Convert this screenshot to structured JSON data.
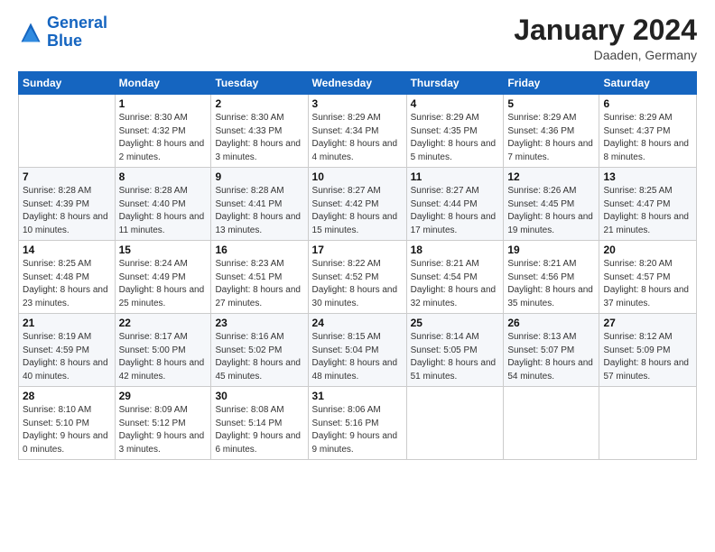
{
  "logo": {
    "line1": "General",
    "line2": "Blue"
  },
  "title": "January 2024",
  "location": "Daaden, Germany",
  "days_header": [
    "Sunday",
    "Monday",
    "Tuesday",
    "Wednesday",
    "Thursday",
    "Friday",
    "Saturday"
  ],
  "weeks": [
    [
      {
        "day": "",
        "sunrise": "",
        "sunset": "",
        "daylight": ""
      },
      {
        "day": "1",
        "sunrise": "Sunrise: 8:30 AM",
        "sunset": "Sunset: 4:32 PM",
        "daylight": "Daylight: 8 hours and 2 minutes."
      },
      {
        "day": "2",
        "sunrise": "Sunrise: 8:30 AM",
        "sunset": "Sunset: 4:33 PM",
        "daylight": "Daylight: 8 hours and 3 minutes."
      },
      {
        "day": "3",
        "sunrise": "Sunrise: 8:29 AM",
        "sunset": "Sunset: 4:34 PM",
        "daylight": "Daylight: 8 hours and 4 minutes."
      },
      {
        "day": "4",
        "sunrise": "Sunrise: 8:29 AM",
        "sunset": "Sunset: 4:35 PM",
        "daylight": "Daylight: 8 hours and 5 minutes."
      },
      {
        "day": "5",
        "sunrise": "Sunrise: 8:29 AM",
        "sunset": "Sunset: 4:36 PM",
        "daylight": "Daylight: 8 hours and 7 minutes."
      },
      {
        "day": "6",
        "sunrise": "Sunrise: 8:29 AM",
        "sunset": "Sunset: 4:37 PM",
        "daylight": "Daylight: 8 hours and 8 minutes."
      }
    ],
    [
      {
        "day": "7",
        "sunrise": "Sunrise: 8:28 AM",
        "sunset": "Sunset: 4:39 PM",
        "daylight": "Daylight: 8 hours and 10 minutes."
      },
      {
        "day": "8",
        "sunrise": "Sunrise: 8:28 AM",
        "sunset": "Sunset: 4:40 PM",
        "daylight": "Daylight: 8 hours and 11 minutes."
      },
      {
        "day": "9",
        "sunrise": "Sunrise: 8:28 AM",
        "sunset": "Sunset: 4:41 PM",
        "daylight": "Daylight: 8 hours and 13 minutes."
      },
      {
        "day": "10",
        "sunrise": "Sunrise: 8:27 AM",
        "sunset": "Sunset: 4:42 PM",
        "daylight": "Daylight: 8 hours and 15 minutes."
      },
      {
        "day": "11",
        "sunrise": "Sunrise: 8:27 AM",
        "sunset": "Sunset: 4:44 PM",
        "daylight": "Daylight: 8 hours and 17 minutes."
      },
      {
        "day": "12",
        "sunrise": "Sunrise: 8:26 AM",
        "sunset": "Sunset: 4:45 PM",
        "daylight": "Daylight: 8 hours and 19 minutes."
      },
      {
        "day": "13",
        "sunrise": "Sunrise: 8:25 AM",
        "sunset": "Sunset: 4:47 PM",
        "daylight": "Daylight: 8 hours and 21 minutes."
      }
    ],
    [
      {
        "day": "14",
        "sunrise": "Sunrise: 8:25 AM",
        "sunset": "Sunset: 4:48 PM",
        "daylight": "Daylight: 8 hours and 23 minutes."
      },
      {
        "day": "15",
        "sunrise": "Sunrise: 8:24 AM",
        "sunset": "Sunset: 4:49 PM",
        "daylight": "Daylight: 8 hours and 25 minutes."
      },
      {
        "day": "16",
        "sunrise": "Sunrise: 8:23 AM",
        "sunset": "Sunset: 4:51 PM",
        "daylight": "Daylight: 8 hours and 27 minutes."
      },
      {
        "day": "17",
        "sunrise": "Sunrise: 8:22 AM",
        "sunset": "Sunset: 4:52 PM",
        "daylight": "Daylight: 8 hours and 30 minutes."
      },
      {
        "day": "18",
        "sunrise": "Sunrise: 8:21 AM",
        "sunset": "Sunset: 4:54 PM",
        "daylight": "Daylight: 8 hours and 32 minutes."
      },
      {
        "day": "19",
        "sunrise": "Sunrise: 8:21 AM",
        "sunset": "Sunset: 4:56 PM",
        "daylight": "Daylight: 8 hours and 35 minutes."
      },
      {
        "day": "20",
        "sunrise": "Sunrise: 8:20 AM",
        "sunset": "Sunset: 4:57 PM",
        "daylight": "Daylight: 8 hours and 37 minutes."
      }
    ],
    [
      {
        "day": "21",
        "sunrise": "Sunrise: 8:19 AM",
        "sunset": "Sunset: 4:59 PM",
        "daylight": "Daylight: 8 hours and 40 minutes."
      },
      {
        "day": "22",
        "sunrise": "Sunrise: 8:17 AM",
        "sunset": "Sunset: 5:00 PM",
        "daylight": "Daylight: 8 hours and 42 minutes."
      },
      {
        "day": "23",
        "sunrise": "Sunrise: 8:16 AM",
        "sunset": "Sunset: 5:02 PM",
        "daylight": "Daylight: 8 hours and 45 minutes."
      },
      {
        "day": "24",
        "sunrise": "Sunrise: 8:15 AM",
        "sunset": "Sunset: 5:04 PM",
        "daylight": "Daylight: 8 hours and 48 minutes."
      },
      {
        "day": "25",
        "sunrise": "Sunrise: 8:14 AM",
        "sunset": "Sunset: 5:05 PM",
        "daylight": "Daylight: 8 hours and 51 minutes."
      },
      {
        "day": "26",
        "sunrise": "Sunrise: 8:13 AM",
        "sunset": "Sunset: 5:07 PM",
        "daylight": "Daylight: 8 hours and 54 minutes."
      },
      {
        "day": "27",
        "sunrise": "Sunrise: 8:12 AM",
        "sunset": "Sunset: 5:09 PM",
        "daylight": "Daylight: 8 hours and 57 minutes."
      }
    ],
    [
      {
        "day": "28",
        "sunrise": "Sunrise: 8:10 AM",
        "sunset": "Sunset: 5:10 PM",
        "daylight": "Daylight: 9 hours and 0 minutes."
      },
      {
        "day": "29",
        "sunrise": "Sunrise: 8:09 AM",
        "sunset": "Sunset: 5:12 PM",
        "daylight": "Daylight: 9 hours and 3 minutes."
      },
      {
        "day": "30",
        "sunrise": "Sunrise: 8:08 AM",
        "sunset": "Sunset: 5:14 PM",
        "daylight": "Daylight: 9 hours and 6 minutes."
      },
      {
        "day": "31",
        "sunrise": "Sunrise: 8:06 AM",
        "sunset": "Sunset: 5:16 PM",
        "daylight": "Daylight: 9 hours and 9 minutes."
      },
      {
        "day": "",
        "sunrise": "",
        "sunset": "",
        "daylight": ""
      },
      {
        "day": "",
        "sunrise": "",
        "sunset": "",
        "daylight": ""
      },
      {
        "day": "",
        "sunrise": "",
        "sunset": "",
        "daylight": ""
      }
    ]
  ]
}
